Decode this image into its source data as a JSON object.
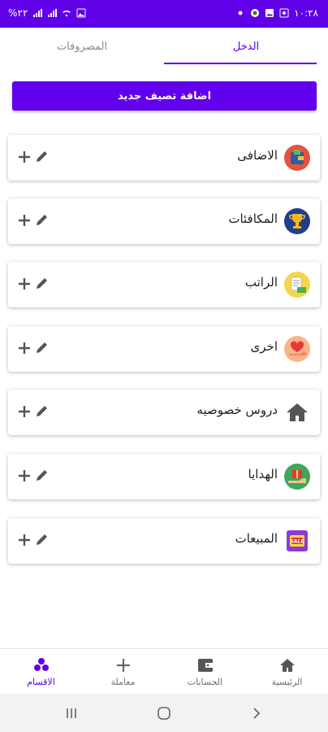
{
  "status_bar": {
    "left_text": "%۲۲",
    "time": "١٠:٢٨"
  },
  "tabs": {
    "expenses": "المصروفات",
    "income": "الدخل"
  },
  "add_category_label": "اضافة تصيف جديد",
  "categories": [
    {
      "label": "الاضافى",
      "icon": "wallet-icon"
    },
    {
      "label": "المكافئات",
      "icon": "trophy-icon"
    },
    {
      "label": "الراتب",
      "icon": "salary-icon"
    },
    {
      "label": "اخرى",
      "icon": "heart-hand-icon"
    },
    {
      "label": "دروس خصوصيه",
      "icon": "home-icon"
    },
    {
      "label": "الهدايا",
      "icon": "gift-icon"
    },
    {
      "label": "المبيعات",
      "icon": "sale-tag-icon"
    }
  ],
  "bottom_nav": {
    "categories": "الاقسام",
    "transaction": "معاملة",
    "accounts": "الحسابات",
    "home": "الرئيسية"
  },
  "colors": {
    "primary": "#6200ee",
    "status_bar": "#5f00e6"
  }
}
